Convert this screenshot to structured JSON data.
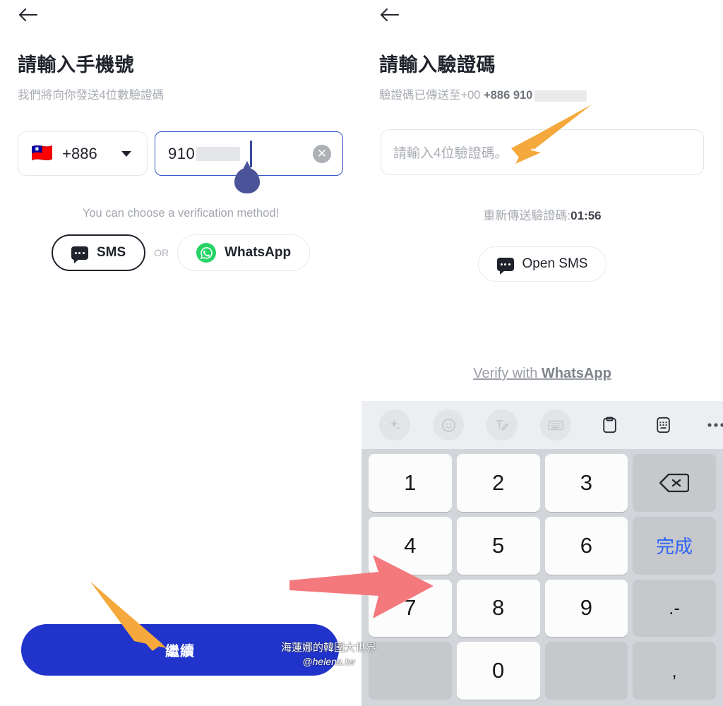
{
  "left_panel": {
    "back_icon": "back-arrow-icon",
    "title": "請輸入手機號",
    "subtitle": "我們將向你發送4位數驗證碼",
    "country": {
      "flag": "🇹🇼",
      "code": "+886",
      "caret_icon": "chevron-down-icon"
    },
    "phone_field": {
      "value": "910",
      "clear_icon": "clear-circle-icon",
      "clear_glyph": "✕"
    },
    "choose_note": "You can choose a verification method!",
    "methods": {
      "sms_label": "SMS",
      "or_label": "OR",
      "whatsapp_label": "WhatsApp",
      "sms_icon": "sms-bubble-icon",
      "whatsapp_icon": "whatsapp-icon"
    },
    "continue_label": "繼續"
  },
  "right_panel": {
    "back_icon": "back-arrow-icon",
    "title": "請輸入驗證碼",
    "subtitle_prefix": "驗證碼已傳送至+00 ",
    "subtitle_number": "+886 910",
    "code_placeholder": "請輸入4位驗證碼。",
    "resend_label": "重新傳送驗證碼:",
    "resend_timer": "01:56",
    "open_sms_label": "Open SMS",
    "open_sms_icon": "sms-bubble-icon",
    "verify_wa_prefix": "Verify with ",
    "verify_wa_brand": "WhatsApp"
  },
  "keyboard": {
    "toolbar": [
      {
        "name": "ai-sparkle-icon",
        "glyph": "✦"
      },
      {
        "name": "emoji-smiley-icon",
        "glyph": "☺"
      },
      {
        "name": "text-edit-pen-icon",
        "glyph": "T"
      },
      {
        "name": "keyboard-icon",
        "glyph": "⌨"
      },
      {
        "name": "clipboard-icon",
        "glyph": "▭"
      },
      {
        "name": "numeric-keypad-icon",
        "glyph": "▤"
      },
      {
        "name": "more-options-icon",
        "glyph": "•••"
      }
    ],
    "keys": [
      {
        "label": "1",
        "kind": "digit",
        "name": "key-1"
      },
      {
        "label": "2",
        "kind": "digit",
        "name": "key-2"
      },
      {
        "label": "3",
        "kind": "digit",
        "name": "key-3"
      },
      {
        "label": "",
        "kind": "backspace",
        "name": "key-backspace"
      },
      {
        "label": "4",
        "kind": "digit",
        "name": "key-4"
      },
      {
        "label": "5",
        "kind": "digit",
        "name": "key-5"
      },
      {
        "label": "6",
        "kind": "digit",
        "name": "key-6"
      },
      {
        "label": "完成",
        "kind": "done",
        "name": "key-done"
      },
      {
        "label": "7",
        "kind": "digit",
        "name": "key-7"
      },
      {
        "label": "8",
        "kind": "digit",
        "name": "key-8"
      },
      {
        "label": "9",
        "kind": "digit",
        "name": "key-9"
      },
      {
        "label": ".-",
        "kind": "sym",
        "name": "key-dot-dash"
      },
      {
        "label": "",
        "kind": "blank",
        "name": "key-blank-left"
      },
      {
        "label": "0",
        "kind": "digit",
        "name": "key-0"
      },
      {
        "label": "",
        "kind": "blank",
        "name": "key-blank-right"
      },
      {
        "label": ",",
        "kind": "sym",
        "name": "key-comma"
      }
    ]
  },
  "annotations": {
    "orange_color": "#F5A93C",
    "red_color": "#F4797D",
    "arrow_code_input": "arrow-pointing-to-code-input",
    "arrow_continue": "arrow-pointing-to-continue-button",
    "arrow_keyboard": "arrow-pointing-to-keyboard"
  },
  "watermark": {
    "line1": "海蓮娜的韓國大世界",
    "line2": "@helena.tw"
  }
}
